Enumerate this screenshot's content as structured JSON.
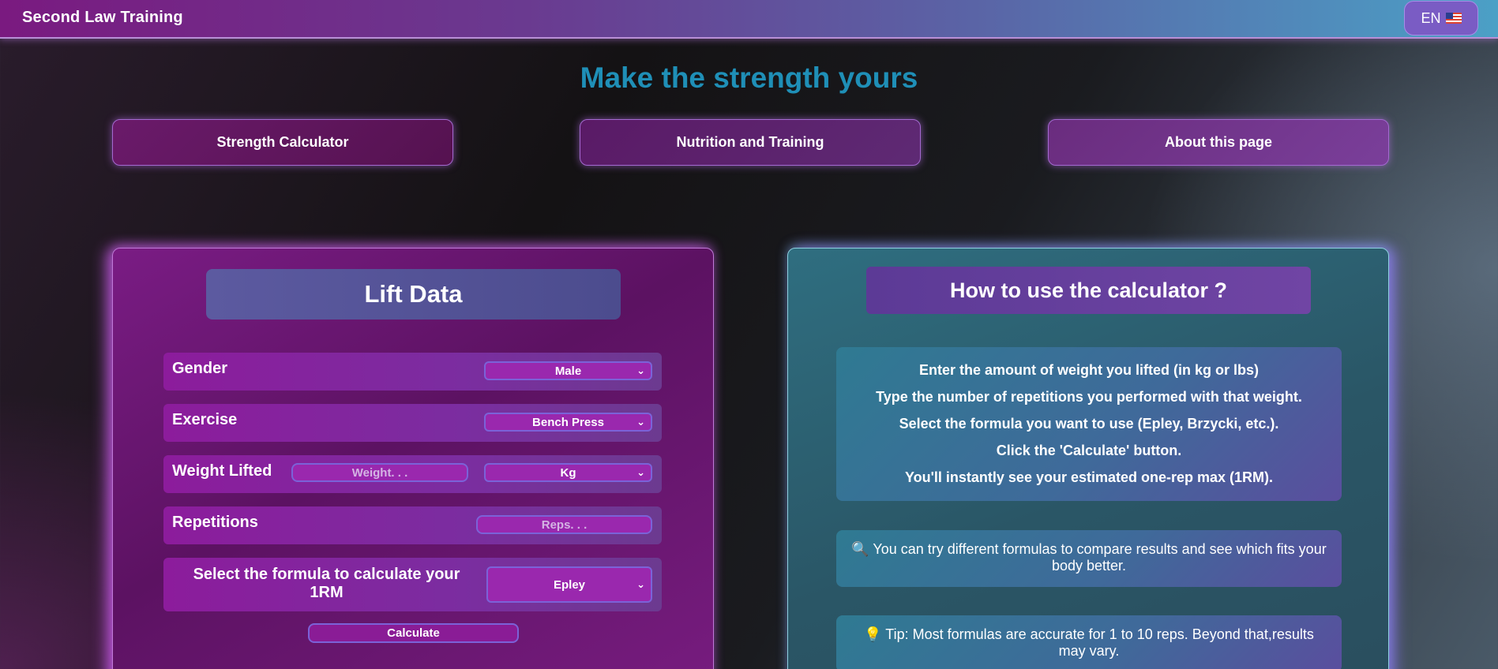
{
  "header": {
    "brand": "Second Law Training",
    "lang_label": "EN",
    "lang_flag_icon": "us-flag-icon"
  },
  "hero": {
    "title": "Make the strength yours"
  },
  "nav": [
    {
      "label": "Strength Calculator"
    },
    {
      "label": "Nutrition and Training"
    },
    {
      "label": "About this page"
    }
  ],
  "lift": {
    "title": "Lift Data",
    "gender": {
      "label": "Gender",
      "value": "Male"
    },
    "exercise": {
      "label": "Exercise",
      "value": "Bench Press"
    },
    "weight": {
      "label": "Weight Lifted",
      "placeholder": "Weight. . .",
      "unit": "Kg"
    },
    "reps": {
      "label": "Repetitions",
      "placeholder": "Reps. . ."
    },
    "formula": {
      "label": "Select the formula to calculate your 1RM",
      "value": "Epley"
    },
    "calculate_label": "Calculate"
  },
  "howto": {
    "title": "How to use the calculator ?",
    "steps": [
      "Enter the amount of weight you lifted (in kg or lbs)",
      "Type the number of repetitions you performed with that weight.",
      "Select the formula you want to use (Epley, Brzycki, etc.).",
      "Click the 'Calculate' button.",
      "You'll instantly see your estimated one-rep max (1RM)."
    ],
    "tip1": {
      "icon": "🔍",
      "text": "You can try different formulas to compare results and see which fits your body better."
    },
    "tip2": {
      "icon": "💡",
      "text": "Tip: Most formulas are accurate for 1 to 10 reps. Beyond that,results may vary."
    }
  },
  "colors": {
    "accent_title": "#1f8fb7",
    "panel_left": "#6a1670",
    "panel_right": "#2c6072",
    "input_bg": "#9a28ae"
  }
}
